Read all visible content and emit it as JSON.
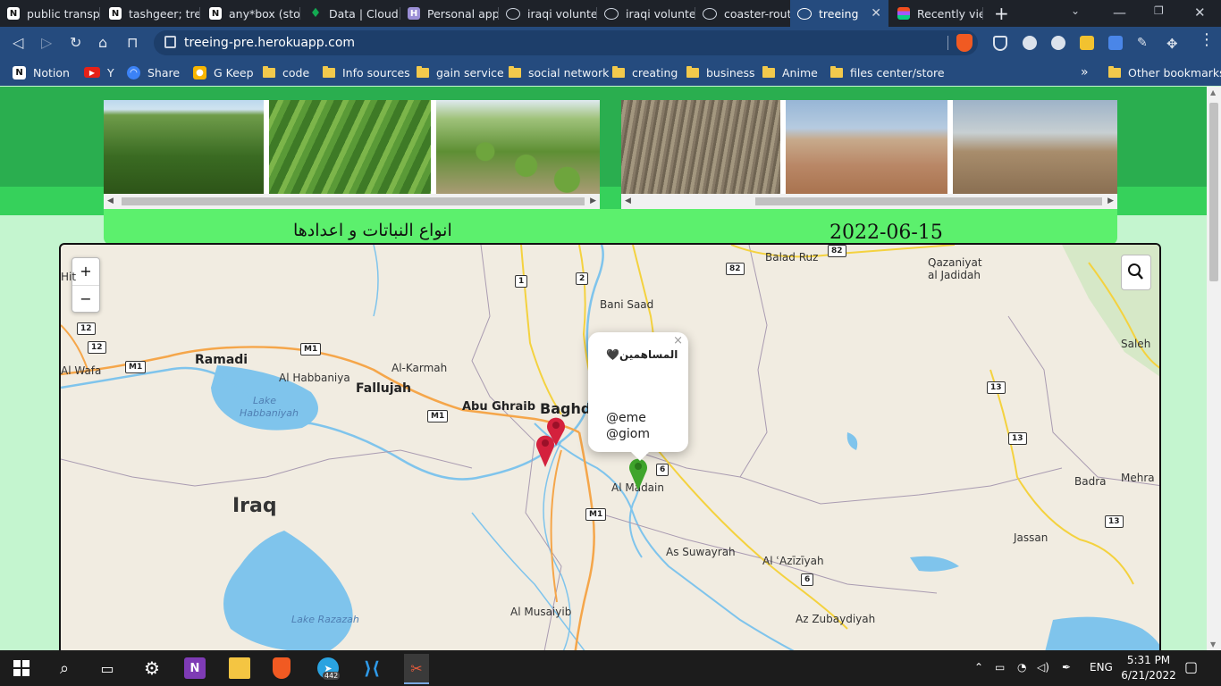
{
  "browser": {
    "tabs": [
      {
        "title": "public transpo",
        "icon": "notion-icon"
      },
      {
        "title": "tashgeer; tree",
        "icon": "notion-icon"
      },
      {
        "title": "any*box (stor",
        "icon": "notion-icon"
      },
      {
        "title": "Data | Cloud:",
        "icon": "mongodb-icon"
      },
      {
        "title": "Personal apps",
        "icon": "heroku-icon"
      },
      {
        "title": "iraqi voluntee",
        "icon": "globe-icon"
      },
      {
        "title": "iraqi voluntee",
        "icon": "globe-icon"
      },
      {
        "title": "coaster-route",
        "icon": "globe-icon"
      },
      {
        "title": "treeing",
        "icon": "globe-icon",
        "active": true
      },
      {
        "title": "Recently view",
        "icon": "figma-icon"
      }
    ],
    "url": "treeing-pre.herokuapp.com",
    "bookmarks": [
      {
        "label": "Notion",
        "icon": "notion-icon"
      },
      {
        "label": "Y",
        "icon": "youtube-icon"
      },
      {
        "label": "Share",
        "icon": "share-icon"
      },
      {
        "label": "G Keep",
        "icon": "keep-icon"
      },
      {
        "label": "code",
        "icon": "folder-icon"
      },
      {
        "label": "Info sources",
        "icon": "folder-icon"
      },
      {
        "label": "gain service",
        "icon": "folder-icon"
      },
      {
        "label": "social network",
        "icon": "folder-icon"
      },
      {
        "label": "creating",
        "icon": "folder-icon"
      },
      {
        "label": "business",
        "icon": "folder-icon"
      },
      {
        "label": "Anime",
        "icon": "folder-icon"
      },
      {
        "label": "files center/store",
        "icon": "folder-icon"
      }
    ],
    "bookmarks_overflow": "»",
    "other_bookmarks": "Other bookmarks"
  },
  "page": {
    "plants_caption": "انواع النباتات و اعدادها",
    "date_caption": "2022-06-15",
    "map": {
      "zoom_in": "+",
      "zoom_out": "−",
      "country_label": "Iraq",
      "cities": [
        "Ramadi",
        "Fallujah",
        "Abu Ghraib",
        "Baghda",
        "Al Habbaniya",
        "Al-Karmah",
        "Bani Saad",
        "Balad Ruz",
        "Qazaniyat al Jadidah",
        "Saleh",
        "Al Madain",
        "As Suwayrah",
        "Al ʿAzīzīyah",
        "Az Zubaydiyah",
        "Al Musaiyib",
        "Jassan",
        "Badra",
        "Mehra",
        "Al Wafa",
        "Hit"
      ],
      "lakes": [
        "Lake Habbaniyah",
        "Lake Razazah"
      ],
      "road_shields": [
        "1",
        "2",
        "82",
        "82",
        "12",
        "12",
        "M1",
        "M1",
        "M1",
        "M1",
        "13",
        "13",
        "13",
        "6",
        "6"
      ],
      "popup": {
        "title": "المساهمين🖤",
        "lines": [
          "@eme",
          "@giom"
        ],
        "close": "×"
      },
      "markers": [
        {
          "color": "#d4213d",
          "icon": "map-pin-icon"
        },
        {
          "color": "#d4213d",
          "icon": "map-pin-icon"
        },
        {
          "color": "#3fa52c",
          "icon": "map-pin-icon"
        }
      ]
    }
  },
  "taskbar": {
    "lang": "ENG",
    "time": "5:31 PM",
    "date": "6/21/2022",
    "telegram_badge": "442"
  }
}
